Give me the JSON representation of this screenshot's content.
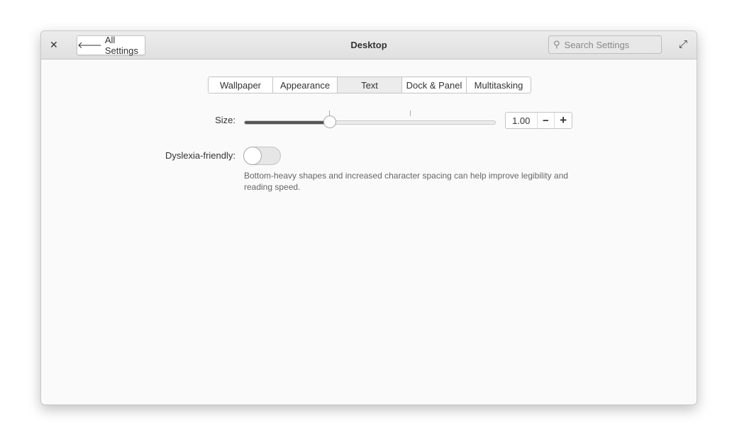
{
  "header": {
    "close_icon": "close-icon",
    "back_label": "All Settings",
    "title": "Desktop",
    "search_placeholder": "Search Settings",
    "maximize_icon": "maximize-icon"
  },
  "tabs": [
    {
      "label": "Wallpaper"
    },
    {
      "label": "Appearance"
    },
    {
      "label": "Text",
      "active": true
    },
    {
      "label": "Dock & Panel"
    },
    {
      "label": "Multitasking"
    }
  ],
  "size": {
    "label": "Size:",
    "value": "1.00",
    "slider_fraction": 0.34,
    "minus": "−",
    "plus": "+"
  },
  "dyslexia": {
    "label": "Dyslexia-friendly:",
    "enabled": false,
    "description": "Bottom-heavy shapes and increased character spacing can help improve legibility and reading speed."
  }
}
